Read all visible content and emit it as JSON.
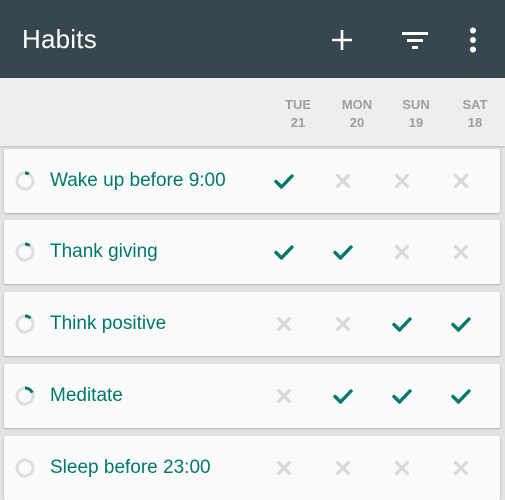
{
  "toolbar": {
    "title": "Habits",
    "background": "#37474f",
    "actions": [
      "add-icon",
      "filter-icon",
      "more-vert-icon"
    ]
  },
  "colors": {
    "accent": "#00796b",
    "check": "#00796b",
    "cross": "#d9d9d9",
    "ring_track": "#dddddd"
  },
  "days": [
    {
      "weekday": "TUE",
      "date": "21"
    },
    {
      "weekday": "MON",
      "date": "20"
    },
    {
      "weekday": "SUN",
      "date": "19"
    },
    {
      "weekday": "SAT",
      "date": "18"
    }
  ],
  "habits": [
    {
      "name": "Wake up before 9:00",
      "score": 0.08,
      "checks": [
        true,
        false,
        false,
        false
      ]
    },
    {
      "name": "Thank giving",
      "score": 0.1,
      "checks": [
        true,
        true,
        false,
        false
      ]
    },
    {
      "name": "Think positive",
      "score": 0.12,
      "checks": [
        false,
        false,
        true,
        true
      ]
    },
    {
      "name": "Meditate",
      "score": 0.18,
      "checks": [
        false,
        true,
        true,
        true
      ]
    },
    {
      "name": "Sleep before 23:00",
      "score": 0.0,
      "checks": [
        false,
        false,
        false,
        false
      ]
    }
  ]
}
